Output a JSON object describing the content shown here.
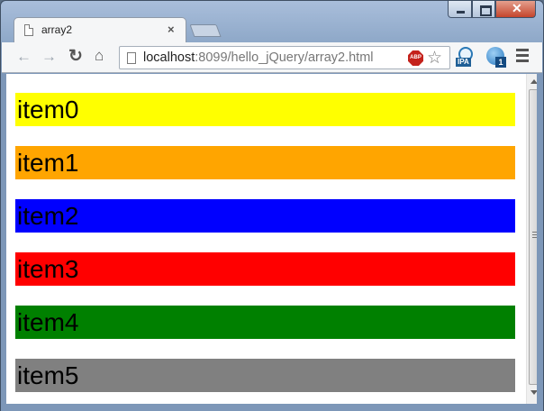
{
  "window": {
    "tab_title": "array2",
    "tab_close": "×"
  },
  "toolbar": {
    "back_icon": "←",
    "forward_icon": "→",
    "reload_icon": "↻",
    "home_icon": "⌂",
    "url_host": "localhost",
    "url_rest": ":8099/hello_jQuery/array2.html",
    "abp_label": "ABP",
    "star_icon": "☆",
    "ipa_label": "IPA",
    "download_badge": "1"
  },
  "colors": {
    "item0": "#ffff00",
    "item1": "#ffa500",
    "item2": "#0000ff",
    "item3": "#ff0000",
    "item4": "#008000",
    "item5": "#808080"
  },
  "items": [
    {
      "label": "item0",
      "color": "#ffff00"
    },
    {
      "label": "item1",
      "color": "#ffa500"
    },
    {
      "label": "item2",
      "color": "#0000ff"
    },
    {
      "label": "item3",
      "color": "#ff0000"
    },
    {
      "label": "item4",
      "color": "#008000"
    },
    {
      "label": "item5",
      "color": "#808080"
    }
  ]
}
